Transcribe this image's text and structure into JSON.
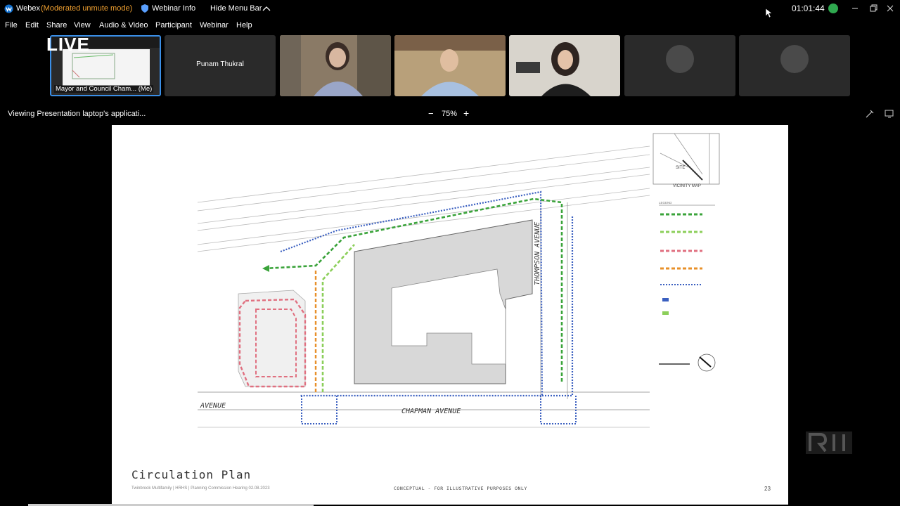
{
  "titlebar": {
    "app_name": "Webex",
    "mode": "(Moderated unmute mode)",
    "webinar_info": "Webinar Info",
    "hide_menu": "Hide Menu Bar",
    "timer": "01:01:44"
  },
  "menu": [
    "File",
    "Edit",
    "Share",
    "View",
    "Audio & Video",
    "Participant",
    "Webinar",
    "Help"
  ],
  "participants": {
    "me_label": "Mayor and Council Cham... (Me)",
    "live_overlay": "LIVE",
    "punam": "Punam Thukral"
  },
  "viewbar": {
    "viewing": "Viewing Presentation laptop's applicati...",
    "zoom_minus": "−",
    "zoom": "75%",
    "zoom_plus": "+"
  },
  "slide": {
    "title": "Circulation Plan",
    "footer_left": "Twinbrook Multifamily  |  HRHS  |  Planning Commission Hearing 02.08.2023",
    "footer_mid": "CONCEPTUAL - FOR ILLUSTRATIVE PURPOSES ONLY",
    "page": "23",
    "streets": {
      "thompson": "THOMPSON AVENUE",
      "chapman": "CHAPMAN AVENUE",
      "avenue": "AVENUE"
    },
    "vicinity": {
      "site": "SITE",
      "title": "VICINITY MAP"
    },
    "legend": {
      "title": "LEGEND"
    }
  },
  "colors": {
    "green_dark": "#3aa33a",
    "green_light": "#8ccf5a",
    "pink": "#e07080",
    "orange": "#e8902a",
    "blue": "#3a5fc0",
    "mode_orange": "#f0a030",
    "me_border": "#3a8ee6"
  },
  "icons": [
    "webex-logo-icon",
    "shield-icon",
    "chevron-up-icon",
    "cursor-icon",
    "network-status-icon",
    "minimize-icon",
    "restore-icon",
    "close-icon",
    "phone-icon",
    "annotate-icon",
    "popout-icon",
    "north-arrow-icon"
  ]
}
